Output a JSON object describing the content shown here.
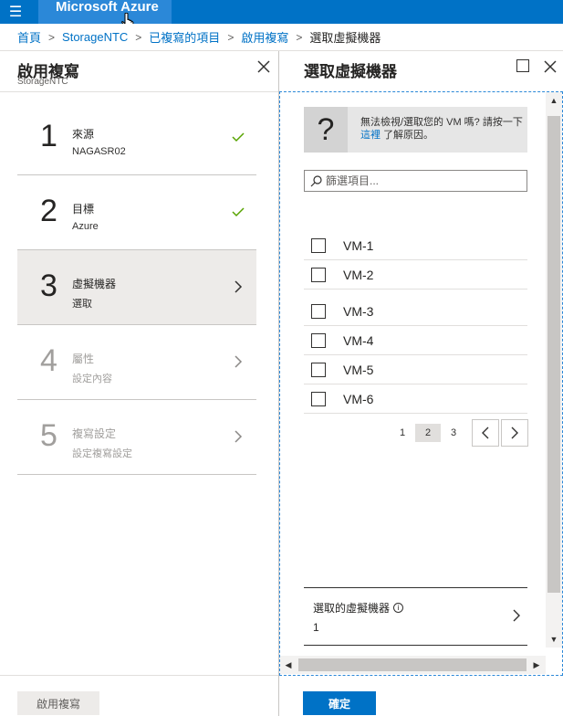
{
  "topbar": {
    "brand": "Microsoft Azure",
    "menu_icon": "hamburger-icon"
  },
  "breadcrumb": {
    "items": [
      "首頁",
      "StorageNTC",
      "已複寫的項目",
      "啟用複寫"
    ],
    "current": "選取虛擬機器"
  },
  "left_blade": {
    "title": "啟用複寫",
    "subtitle": "StorageNTC",
    "steps": [
      {
        "number": "1",
        "label": "來源",
        "sub": "NAGASR02",
        "status": "complete"
      },
      {
        "number": "2",
        "label": "目標",
        "sub": "Azure",
        "status": "complete"
      },
      {
        "number": "3",
        "label": "虛擬機器",
        "sub": "選取",
        "status": "active"
      },
      {
        "number": "4",
        "label": "屬性",
        "sub": "設定內容",
        "status": "disabled"
      },
      {
        "number": "5",
        "label": "複寫設定",
        "sub": "設定複寫設定",
        "status": "disabled"
      }
    ],
    "footer_button": "啟用複寫"
  },
  "right_blade": {
    "title": "選取虛擬機器",
    "info": {
      "text_before": "無法檢視/選取您的 VM 嗎? 請按一下",
      "link": "這裡",
      "text_after": "了解原因。"
    },
    "filter_placeholder": "篩選項目...",
    "vms": [
      "VM-1",
      "VM-2",
      "VM-3",
      "VM-4",
      "VM-5",
      "VM-6"
    ],
    "pagination": {
      "pages": [
        "1",
        "2",
        "3"
      ],
      "current": "2"
    },
    "selected": {
      "label": "選取的虛擬機器",
      "value": "1"
    },
    "confirm_button": "確定"
  },
  "colors": {
    "azure_blue": "#0072c6",
    "brand_highlight": "#2b88d8",
    "check_green": "#57a300"
  }
}
